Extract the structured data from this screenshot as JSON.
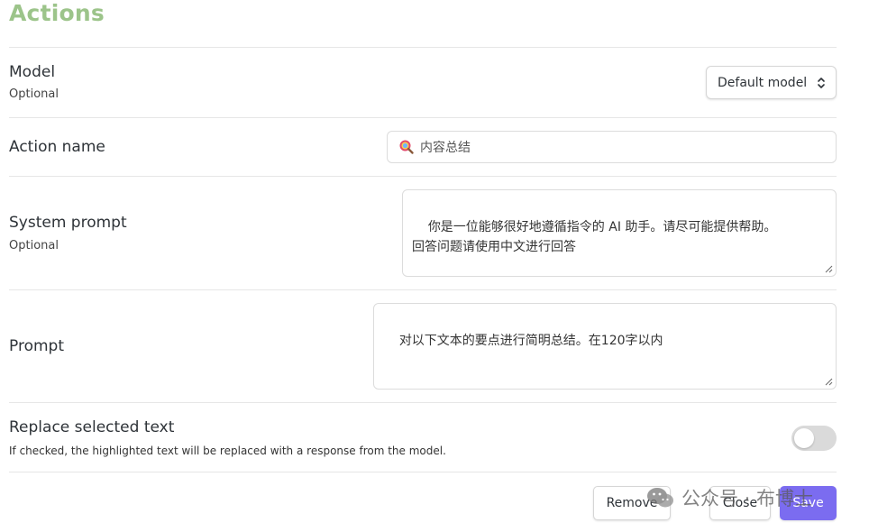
{
  "header": {
    "title": "Actions"
  },
  "model": {
    "label": "Model",
    "sublabel": "Optional",
    "selected": "Default model"
  },
  "action_name": {
    "label": "Action name",
    "value": "内容总结",
    "emoji_icon": "magnifier-emoji-icon"
  },
  "system_prompt": {
    "label": "System prompt",
    "sublabel": "Optional",
    "value": "你是一位能够很好地遵循指令的 AI 助手。请尽可能提供帮助。\n回答问题请使用中文进行回答"
  },
  "prompt": {
    "label": "Prompt",
    "value": "对以下文本的要点进行简明总结。在120字以内"
  },
  "replace_selected": {
    "label": "Replace selected text",
    "description": "If checked, the highlighted text will be replaced with a response from the model.",
    "checked": false
  },
  "footer": {
    "remove_label": "Remove",
    "close_label": "Close",
    "save_label": "Save"
  },
  "watermark": {
    "text": "公众号 · 布博士"
  },
  "colors": {
    "title": "#9cc48a",
    "accent": "#7b6cf0",
    "toggle_off": "#dadada"
  }
}
